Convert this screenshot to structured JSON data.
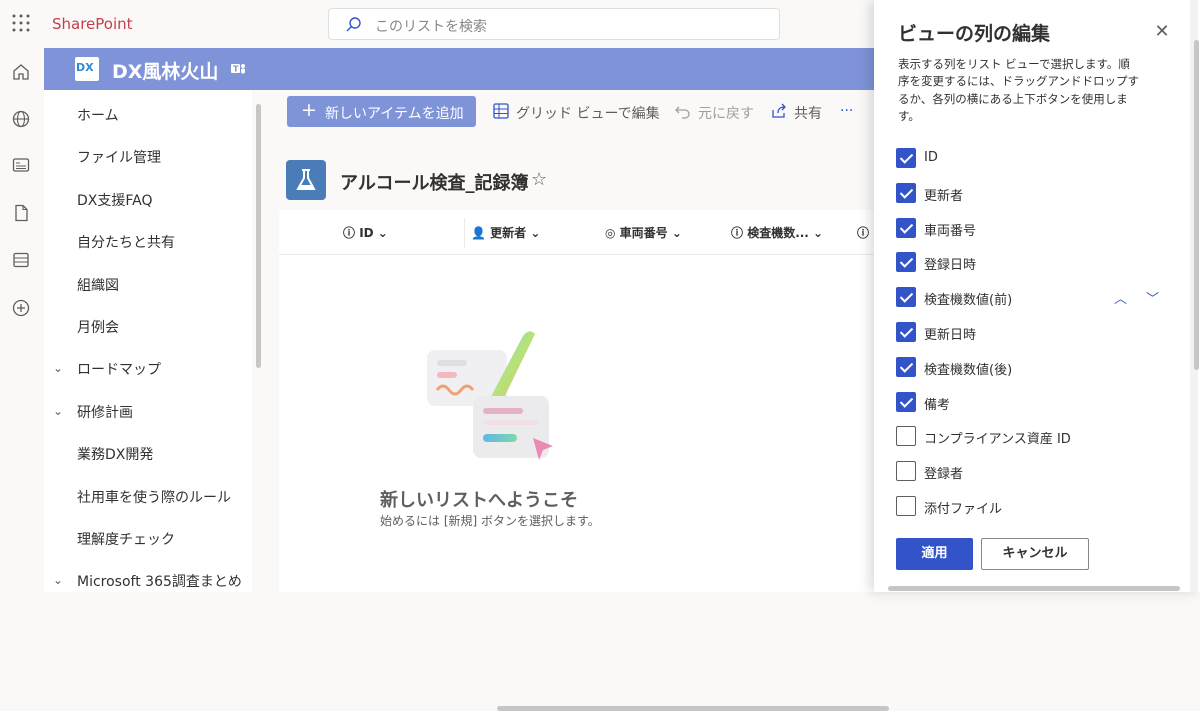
{
  "app": {
    "brand": "SharePoint",
    "search_placeholder": "このリストを検索"
  },
  "site": {
    "title": "DX風林火山",
    "logo_text": "DX"
  },
  "nav": {
    "items": [
      {
        "label": "ホーム",
        "expandable": false
      },
      {
        "label": "ファイル管理",
        "expandable": false
      },
      {
        "label": "DX支援FAQ",
        "expandable": false
      },
      {
        "label": "自分たちと共有",
        "expandable": false
      },
      {
        "label": "組織図",
        "expandable": false
      },
      {
        "label": "月例会",
        "expandable": false
      },
      {
        "label": "ロードマップ",
        "expandable": true
      },
      {
        "label": "研修計画",
        "expandable": true
      },
      {
        "label": "業務DX開発",
        "expandable": false
      },
      {
        "label": "社用車を使う際のルール",
        "expandable": false
      },
      {
        "label": "理解度チェック",
        "expandable": false
      },
      {
        "label": "Microsoft 365調査まとめ",
        "expandable": true
      }
    ]
  },
  "commandbar": {
    "new_item": "新しいアイテムを追加",
    "grid_edit": "グリッド ビューで編集",
    "undo": "元に戻す",
    "share": "共有",
    "more": "···"
  },
  "list": {
    "name": "アルコール検査_記録簿",
    "columns": [
      "ID",
      "更新者",
      "車両番号",
      "検査機数..."
    ],
    "empty_title": "新しいリストへようこそ",
    "empty_sub": "始めるには [新規] ボタンを選択します。"
  },
  "panel": {
    "title": "ビューの列の編集",
    "description": "表示する列をリスト ビューで選択します。順序を変更するには、ドラッグアンドドロップするか、各列の横にある上下ボタンを使用します。",
    "columns": [
      {
        "label": "ID",
        "checked": true
      },
      {
        "label": "更新者",
        "checked": true
      },
      {
        "label": "車両番号",
        "checked": true
      },
      {
        "label": "登録日時",
        "checked": true
      },
      {
        "label": "検査機数値(前)",
        "checked": true
      },
      {
        "label": "更新日時",
        "checked": true
      },
      {
        "label": "検査機数値(後)",
        "checked": true
      },
      {
        "label": "備考",
        "checked": true
      },
      {
        "label": "コンプライアンス資産 ID",
        "checked": false
      },
      {
        "label": "登録者",
        "checked": false
      },
      {
        "label": "添付ファイル",
        "checked": false
      }
    ],
    "apply": "適用",
    "cancel": "キャンセル"
  },
  "colors": {
    "accent": "#3354c8",
    "site_header": "#7f93d9",
    "brand": "#c43e4a"
  }
}
